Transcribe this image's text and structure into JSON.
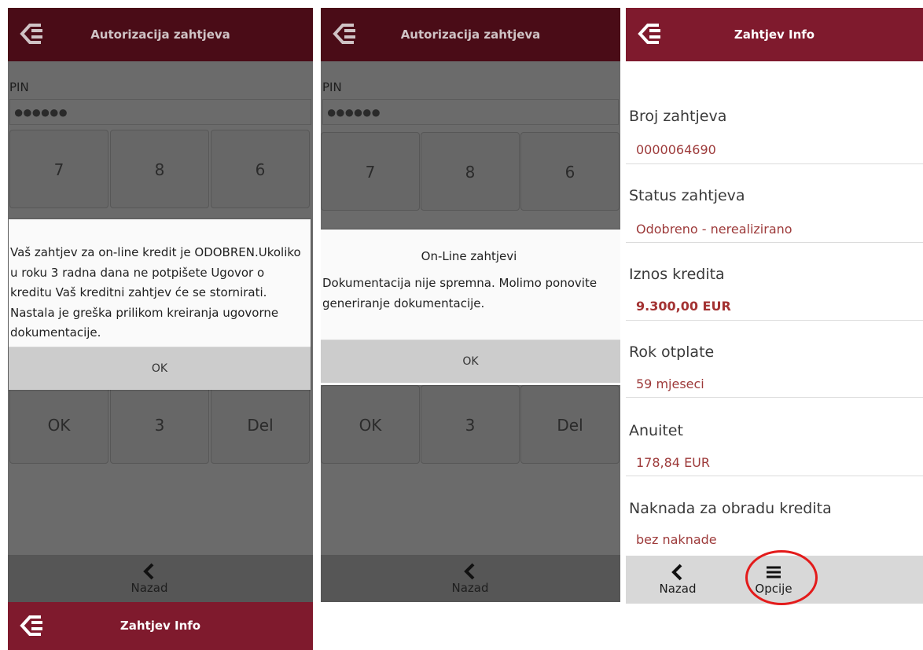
{
  "panel1": {
    "title": "Autorizacija zahtjeva",
    "pin_label": "PIN",
    "pin_dots": "●●●●●●",
    "keys": [
      "7",
      "8",
      "6",
      "OK",
      "3",
      "Del"
    ],
    "dialog_text": "Vaš zahtjev za on-line kredit je ODOBREN.Ukoliko u roku 3 radna dana ne potpišete Ugovor o kreditu Vaš kreditni zahtjev će se stornirati.  Nastala je greška prilikom kreiranja ugovorne dokumentacije.",
    "dialog_ok": "OK",
    "back_label": "Nazad"
  },
  "panel2": {
    "title": "Autorizacija zahtjeva",
    "pin_label": "PIN",
    "pin_dots": "●●●●●●",
    "keys": [
      "7",
      "8",
      "6",
      "OK",
      "3",
      "Del"
    ],
    "dialog_title": "On-Line zahtjevi",
    "dialog_text": "Dokumentacija nije spremna. Molimo ponovite generiranje dokumentacije.",
    "dialog_ok": "OK",
    "back_label": "Nazad"
  },
  "panel3": {
    "title": "Zahtjev Info",
    "fields": [
      {
        "label": "Broj zahtjeva",
        "value": "0000064690"
      },
      {
        "label": "Status zahtjeva",
        "value": "Odobreno - nerealizirano"
      },
      {
        "label": "Iznos kredita",
        "value": "9.300,00 EUR"
      },
      {
        "label": "Rok otplate",
        "value": "59 mjeseci"
      },
      {
        "label": "Anuitet",
        "value": "178,84 EUR"
      },
      {
        "label": "Naknada za obradu kredita",
        "value": "bez naknade"
      }
    ],
    "back_label": "Nazad",
    "options_label": "Opcije"
  },
  "panel4": {
    "title": "Zahtjev Info"
  },
  "colors": {
    "dark_header": "#4a0c17",
    "header": "#7f1a2d",
    "value_text": "#9d3a3a",
    "highlight_circle": "#e31b1b"
  },
  "icons": [
    "bank-logo-icon",
    "chevron-left-icon",
    "hamburger-menu-icon"
  ]
}
